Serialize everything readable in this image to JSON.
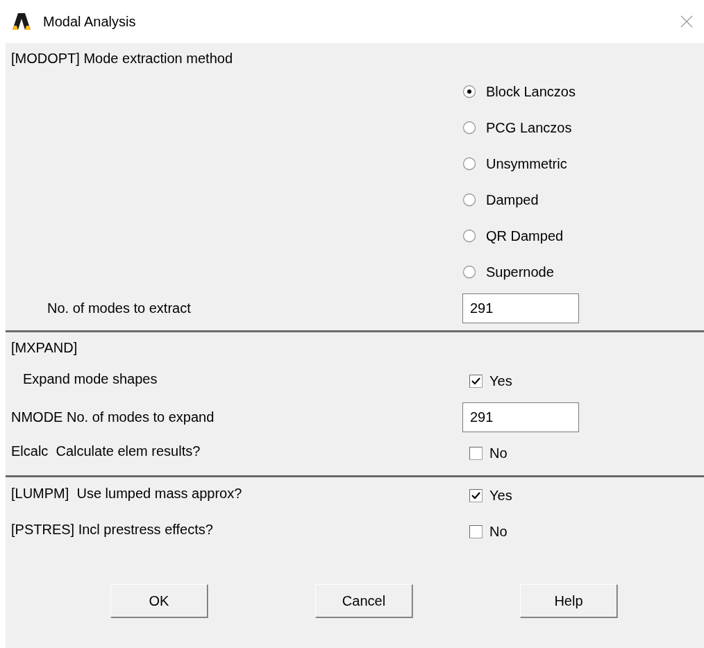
{
  "window": {
    "title": "Modal Analysis"
  },
  "sections": [
    {
      "rows": [
        {
          "kind": "heading",
          "label": "[MODOPT] Mode extraction method"
        },
        {
          "kind": "radio",
          "label": "Block Lanczos",
          "selected": true
        },
        {
          "kind": "radio",
          "label": "PCG Lanczos",
          "selected": false
        },
        {
          "kind": "radio",
          "label": "Unsymmetric",
          "selected": false
        },
        {
          "kind": "radio",
          "label": "Damped",
          "selected": false
        },
        {
          "kind": "radio",
          "label": "QR Damped",
          "selected": false
        },
        {
          "kind": "radio",
          "label": "Supernode",
          "selected": false
        },
        {
          "kind": "insetfield",
          "label": "No. of modes to extract",
          "value": "291"
        }
      ]
    },
    {
      "rows": [
        {
          "kind": "heading",
          "label": "[MXPAND]"
        },
        {
          "kind": "insetcheckbox",
          "label": "Expand mode shapes",
          "option": "Yes",
          "checked": true
        },
        {
          "kind": "field",
          "label": "NMODE No. of modes to expand",
          "value": "291"
        },
        {
          "kind": "checkbox",
          "label": "Elcalc  Calculate elem results?",
          "option": "No",
          "checked": false
        }
      ]
    },
    {
      "rows": [
        {
          "kind": "checkbox",
          "label": "[LUMPM]  Use lumped mass approx?",
          "option": "Yes",
          "checked": true
        },
        {
          "kind": "checkbox",
          "label": "[PSTRES] Incl prestress effects?",
          "option": "No",
          "checked": false
        }
      ]
    }
  ],
  "buttons": [
    "OK",
    "Cancel",
    "Help"
  ]
}
